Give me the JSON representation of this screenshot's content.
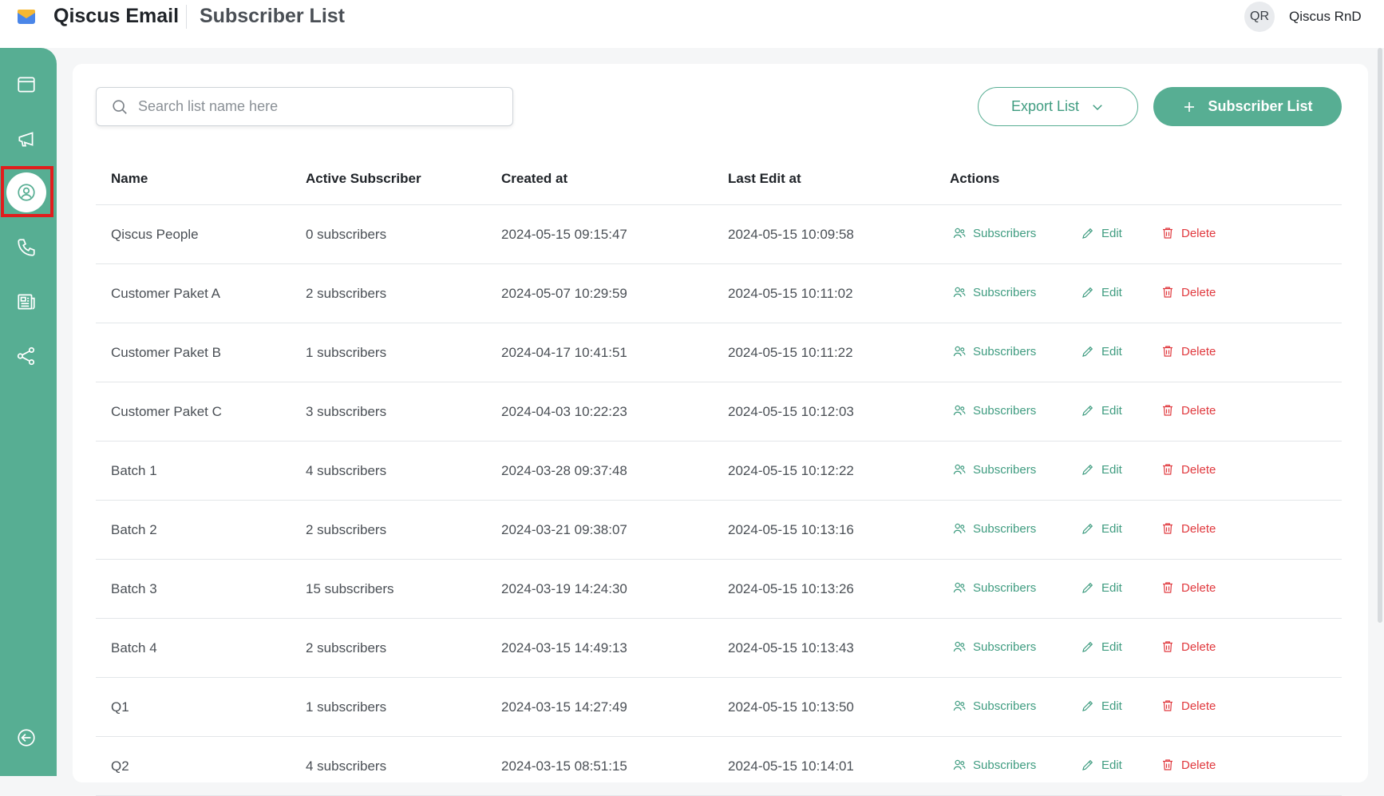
{
  "header": {
    "app_title": "Qiscus Email",
    "page_title": "Subscriber List",
    "avatar_initials": "QR",
    "user_name": "Qiscus RnD"
  },
  "sidebar": {
    "items": [
      {
        "icon": "window-icon"
      },
      {
        "icon": "megaphone-icon"
      },
      {
        "icon": "user-circle-icon",
        "active": true
      },
      {
        "icon": "phone-icon"
      },
      {
        "icon": "newspaper-icon"
      },
      {
        "icon": "share-nodes-icon"
      }
    ],
    "collapse_icon": "arrow-left-circle-icon"
  },
  "toolbar": {
    "search_placeholder": "Search list name here",
    "export_label": "Export List",
    "add_label": "Subscriber List"
  },
  "table": {
    "columns": [
      "Name",
      "Active Subscriber",
      "Created at",
      "Last Edit at",
      "Actions"
    ],
    "action_labels": {
      "subscribers": "Subscribers",
      "edit": "Edit",
      "delete": "Delete"
    },
    "rows": [
      {
        "name": "Qiscus People",
        "active": "0 subscribers",
        "created": "2024-05-15 09:15:47",
        "last_edit": "2024-05-15 10:09:58"
      },
      {
        "name": "Customer Paket A",
        "active": "2 subscribers",
        "created": "2024-05-07 10:29:59",
        "last_edit": "2024-05-15 10:11:02"
      },
      {
        "name": "Customer Paket B",
        "active": "1 subscribers",
        "created": "2024-04-17 10:41:51",
        "last_edit": "2024-05-15 10:11:22"
      },
      {
        "name": "Customer Paket C",
        "active": "3 subscribers",
        "created": "2024-04-03 10:22:23",
        "last_edit": "2024-05-15 10:12:03"
      },
      {
        "name": "Batch 1",
        "active": "4 subscribers",
        "created": "2024-03-28 09:37:48",
        "last_edit": "2024-05-15 10:12:22"
      },
      {
        "name": "Batch 2",
        "active": "2 subscribers",
        "created": "2024-03-21 09:38:07",
        "last_edit": "2024-05-15 10:13:16"
      },
      {
        "name": "Batch 3",
        "active": "15 subscribers",
        "created": "2024-03-19 14:24:30",
        "last_edit": "2024-05-15 10:13:26"
      },
      {
        "name": "Batch 4",
        "active": "2 subscribers",
        "created": "2024-03-15 14:49:13",
        "last_edit": "2024-05-15 10:13:43"
      },
      {
        "name": "Q1",
        "active": "1 subscribers",
        "created": "2024-03-15 14:27:49",
        "last_edit": "2024-05-15 10:13:50"
      },
      {
        "name": "Q2",
        "active": "4 subscribers",
        "created": "2024-03-15 08:51:15",
        "last_edit": "2024-05-15 10:14:01"
      }
    ]
  },
  "colors": {
    "brand": "#57ae93",
    "brand_text": "#3f9c80",
    "danger": "#e0383d",
    "highlight": "#e11d1d"
  }
}
